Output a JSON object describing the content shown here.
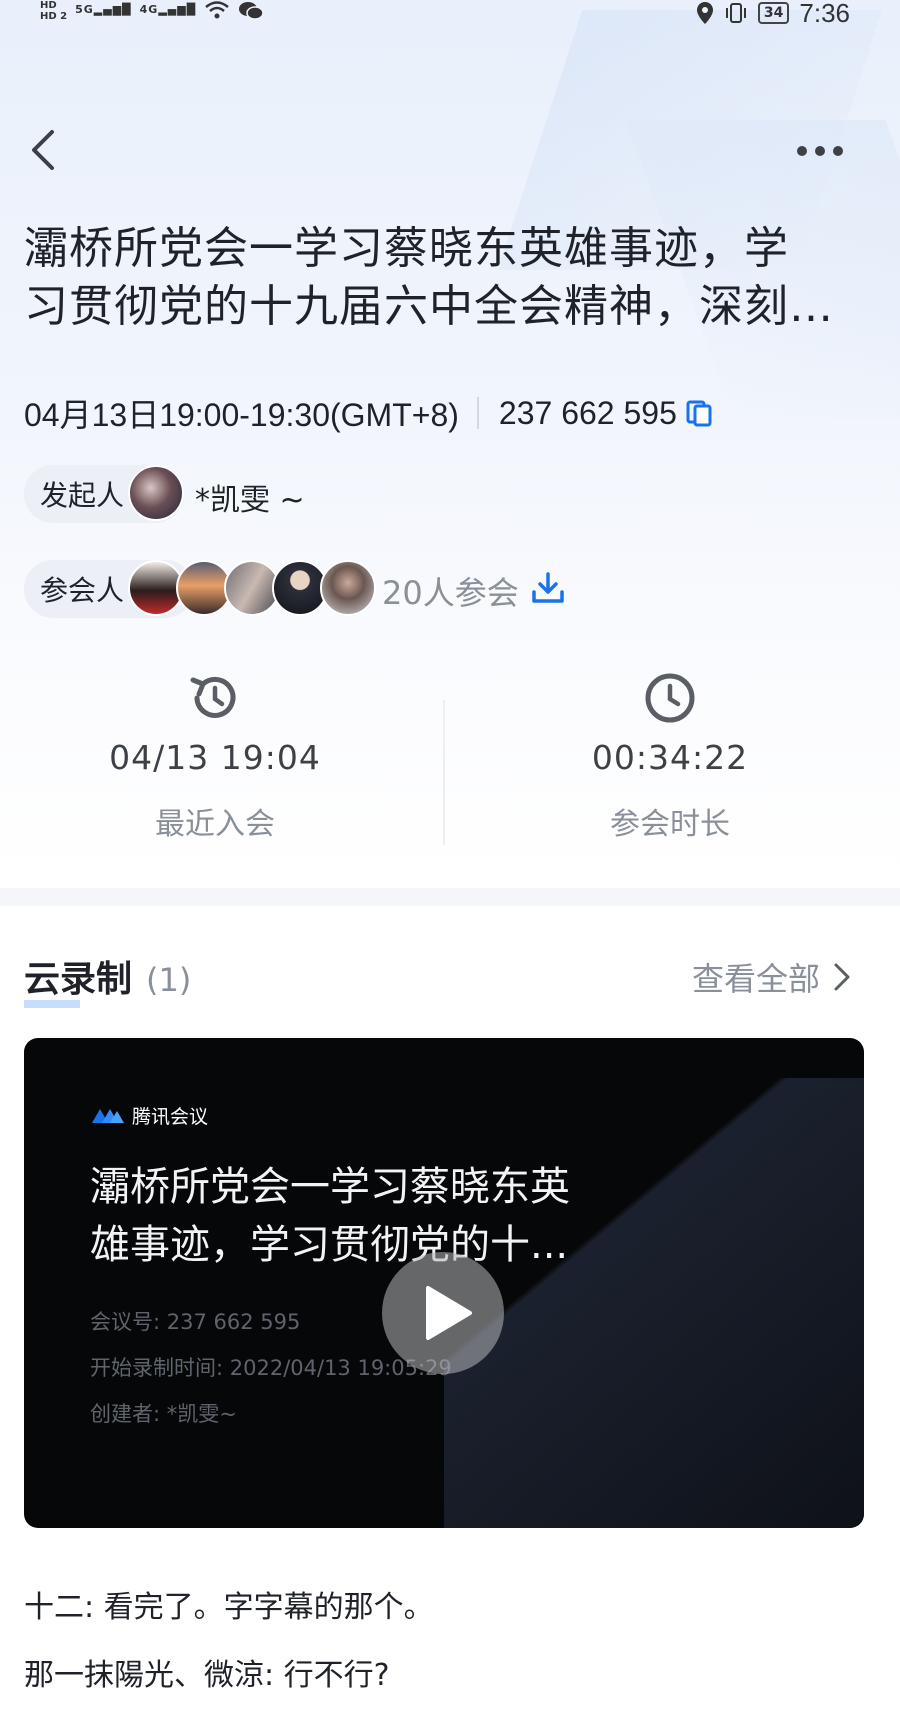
{
  "status_bar": {
    "hd_labels": [
      "HD",
      "HD 2"
    ],
    "signals": [
      "5G",
      "4G"
    ],
    "battery": "34",
    "time": "7:36"
  },
  "header": {
    "back_icon": "chevron-left-icon",
    "more_icon": "more-dots-icon"
  },
  "meeting": {
    "title_line1": "灞桥所党会一学习蔡晓东英雄事迹，学",
    "title_line2": "习贯彻党的十九届六中全会精神，深刻…",
    "time_range": "04月13日19:00-19:30(GMT+8)",
    "meeting_id": "237 662 595",
    "host_label": "发起人",
    "host_name": "*凯雯 ~",
    "participants_label": "参会人",
    "participants_count": "20人参会"
  },
  "stats": {
    "recent_join_value": "04/13 19:04",
    "recent_join_label": "最近入会",
    "duration_value": "00:34:22",
    "duration_label": "参会时长"
  },
  "cloud_recording": {
    "title": "云录制",
    "count": "(1)",
    "view_all": "查看全部",
    "card": {
      "brand": "腾讯会议",
      "title_line1": "灞桥所党会一学习蔡晓东英",
      "title_line2": "雄事迹，学习贯彻党的十...",
      "meeting_no": "会议号: 237 662 595",
      "start_time": "开始录制时间: 2022/04/13 19:05:29",
      "creator": "创建者: *凯雯~"
    }
  },
  "comments": [
    "十二: 看完了。字字幕的那个。",
    "那一抹陽光、微涼: 行不行?"
  ],
  "colors": {
    "accent": "#1a73e8",
    "text_primary": "#1f2329",
    "text_secondary": "#8a9099",
    "card_bg": "#060708"
  }
}
